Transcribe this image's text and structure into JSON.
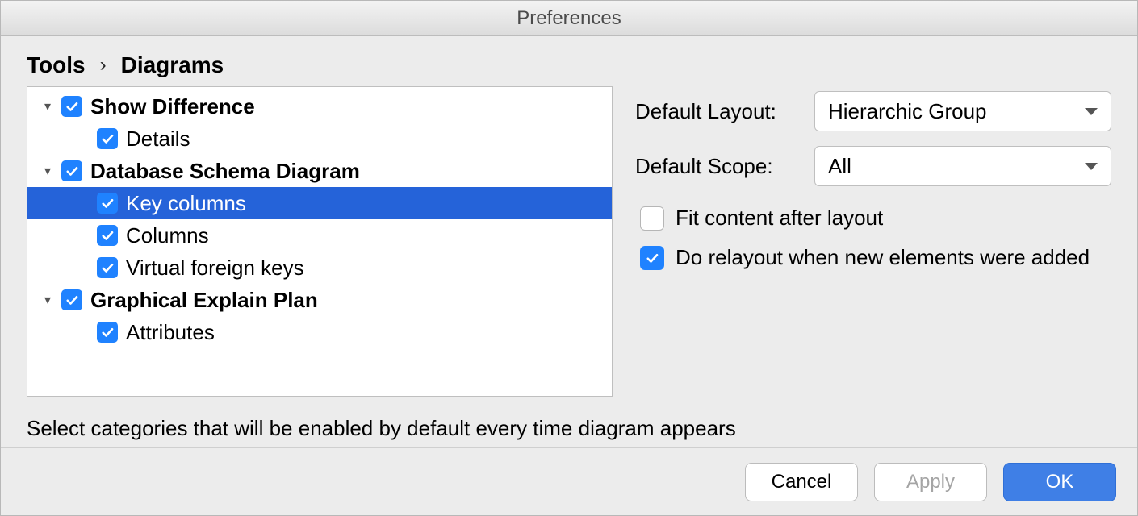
{
  "window": {
    "title": "Preferences"
  },
  "breadcrumb": {
    "root": "Tools",
    "sep": "›",
    "leaf": "Diagrams"
  },
  "tree": {
    "n0": {
      "label": "Show Difference",
      "checked": true,
      "expanded": true
    },
    "n0_0": {
      "label": "Details",
      "checked": true
    },
    "n1": {
      "label": "Database Schema Diagram",
      "checked": true,
      "expanded": true
    },
    "n1_0": {
      "label": "Key columns",
      "checked": true,
      "selected": true
    },
    "n1_1": {
      "label": "Columns",
      "checked": true
    },
    "n1_2": {
      "label": "Virtual foreign keys",
      "checked": true
    },
    "n2": {
      "label": "Graphical Explain Plan",
      "checked": true,
      "expanded": true
    },
    "n2_0": {
      "label": "Attributes",
      "checked": true
    }
  },
  "right": {
    "layout_label": "Default Layout:",
    "layout_value": "Hierarchic Group",
    "scope_label": "Default Scope:",
    "scope_value": "All",
    "fit_label": "Fit content after layout",
    "fit_checked": false,
    "relayout_label": "Do relayout when new elements were added",
    "relayout_checked": true
  },
  "hint": "Select categories that will be enabled by default every time diagram appears",
  "buttons": {
    "cancel": "Cancel",
    "apply": "Apply",
    "ok": "OK"
  }
}
